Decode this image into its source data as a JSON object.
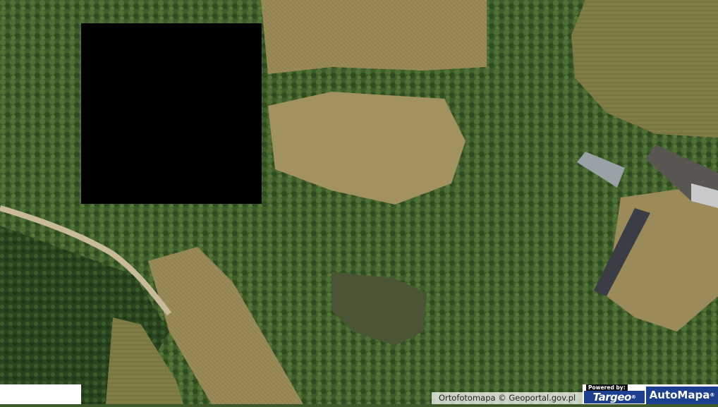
{
  "map": {
    "type": "orthophoto",
    "colors": {
      "forest_dark": "#2f4a22",
      "forest": "#4b6a33",
      "field_dry": "#a08f5c",
      "field_green": "#7c7f45",
      "pond": "#4a5433",
      "path": "#c8b999",
      "roof": "#3d3f47",
      "redaction": "#000000"
    }
  },
  "attribution": {
    "text": "Ortofotomapa © Geoportal.gov.pl"
  },
  "logos": {
    "powered_by": "Powered by:",
    "targeo": "Targeo",
    "automapa": "AutoMapa",
    "registered_mark": "®"
  }
}
